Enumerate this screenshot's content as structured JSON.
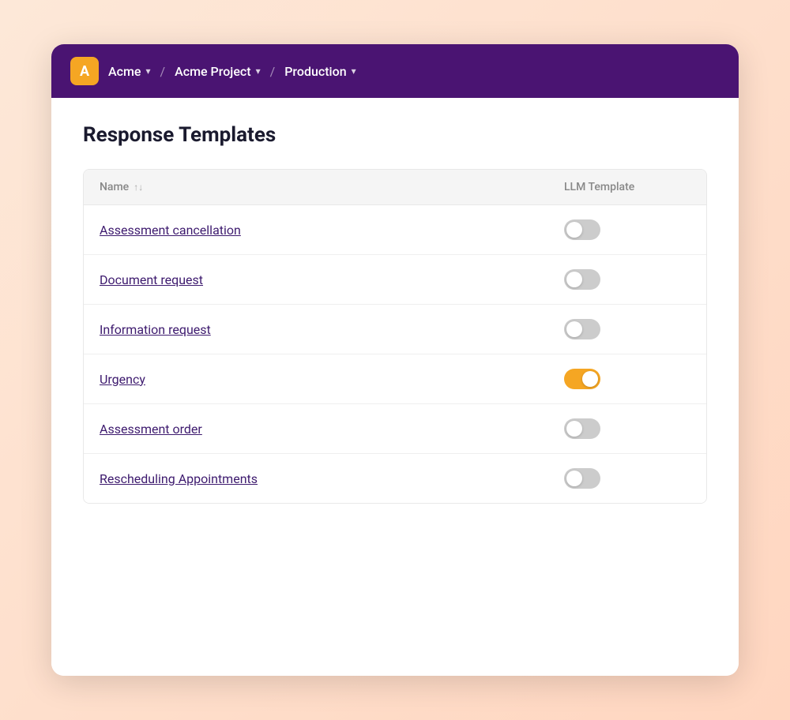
{
  "nav": {
    "logo_letter": "A",
    "breadcrumbs": [
      {
        "label": "Acme",
        "id": "acme"
      },
      {
        "label": "Acme Project",
        "id": "acme-project"
      },
      {
        "label": "Production",
        "id": "production"
      }
    ]
  },
  "page": {
    "title": "Response Templates"
  },
  "table": {
    "columns": [
      {
        "label": "Name",
        "sort": "↑↓"
      },
      {
        "label": "LLM Template"
      }
    ],
    "rows": [
      {
        "name": "Assessment cancellation",
        "enabled": false
      },
      {
        "name": "Document request",
        "enabled": false
      },
      {
        "name": "Information request",
        "enabled": false
      },
      {
        "name": "Urgency",
        "enabled": true
      },
      {
        "name": "Assessment order",
        "enabled": false
      },
      {
        "name": "Rescheduling Appointments",
        "enabled": false
      }
    ]
  }
}
